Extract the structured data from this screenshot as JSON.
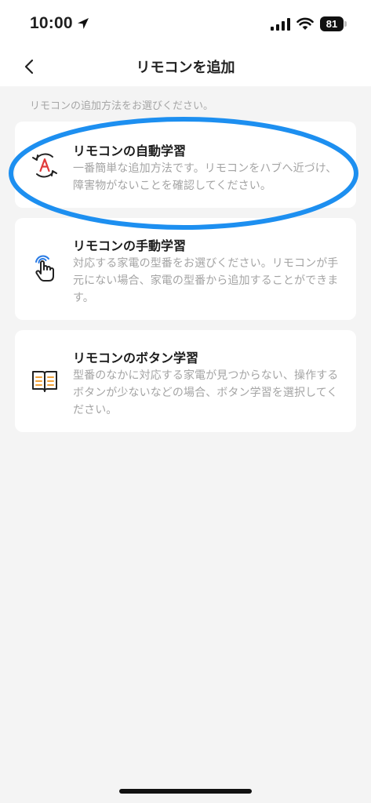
{
  "status_bar": {
    "time": "10:00",
    "battery": "81"
  },
  "nav": {
    "title": "リモコンを追加",
    "back_icon": "chevron-left-icon"
  },
  "instruction": "リモコンの追加方法をお選びください。",
  "options": [
    {
      "title": "リモコンの自動学習",
      "description": "一番簡単な追加方法です。リモコンをハブへ近づけ、障害物がないことを確認してください。",
      "icon": "auto-learn-icon"
    },
    {
      "title": "リモコンの手動学習",
      "description": "対応する家電の型番をお選びください。リモコンが手元にない場合、家電の型番から追加することができます。",
      "icon": "hand-tap-icon"
    },
    {
      "title": "リモコンのボタン学習",
      "description": "型番のなかに対応する家電が見つからない、操作するボタンが少ないなどの場合、ボタン学習を選択してください。",
      "icon": "book-icon"
    }
  ],
  "colors": {
    "highlight_ring": "#1d8ff0",
    "accent_red": "#e03a3a",
    "accent_blue": "#2a7be4",
    "accent_orange": "#f2a33a"
  }
}
